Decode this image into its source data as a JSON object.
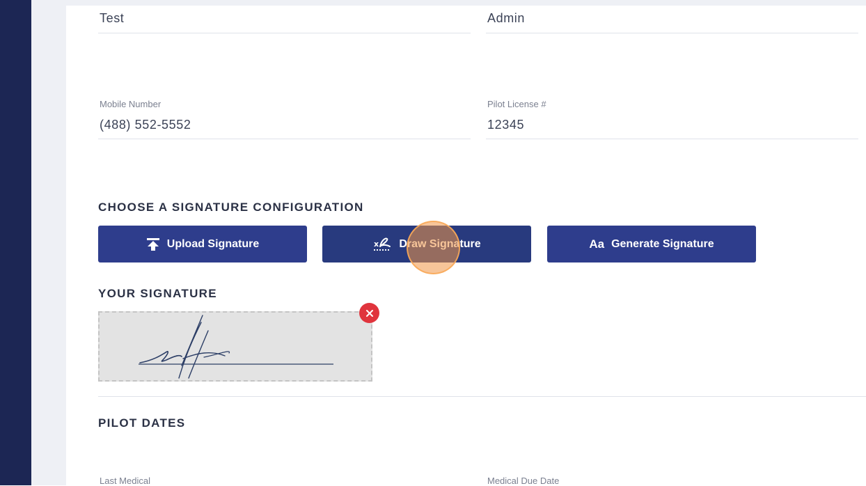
{
  "profile": {
    "first_name": "Test",
    "last_name": "Admin",
    "mobile_label": "Mobile Number",
    "mobile_value": "(488) 552-5552",
    "license_label": "Pilot License #",
    "license_value": "12345"
  },
  "signature_config": {
    "title": "CHOOSE A SIGNATURE CONFIGURATION",
    "upload_label": "Upload Signature",
    "draw_label": "Draw Signature",
    "generate_label": "Generate Signature",
    "generate_icon_text": "Aa",
    "active_button": "Draw Signature"
  },
  "your_signature": {
    "title": "YOUR SIGNATURE"
  },
  "pilot_dates": {
    "title": "PILOT DATES",
    "last_medical_label": "Last Medical",
    "medical_due_label": "Medical Due Date"
  },
  "colors": {
    "nav": "#1c2654",
    "button": "#2e3d8c",
    "remove": "#e0343d",
    "click_marker": "#f0964680"
  },
  "icons": {
    "upload": "upload-arrow-icon",
    "draw": "pen-signature-icon",
    "remove": "close-icon"
  }
}
